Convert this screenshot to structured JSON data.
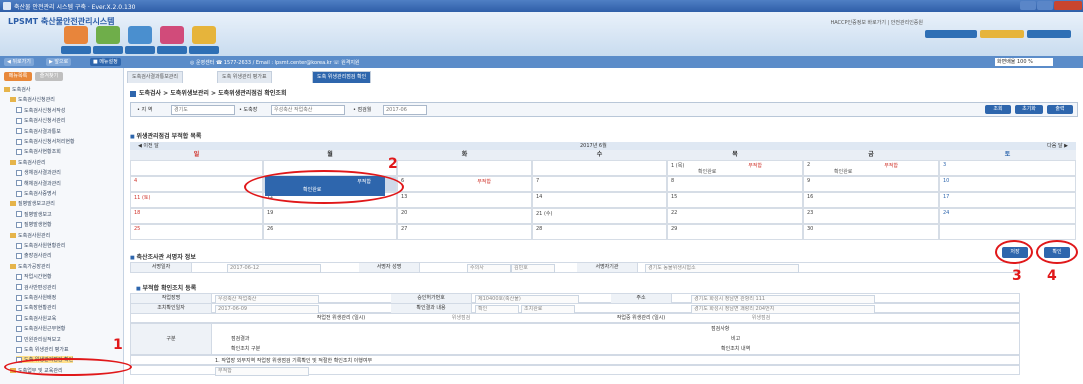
{
  "window": {
    "title": "축산물 안전관리 시스템 구축 · Ever.X.2.0.130"
  },
  "header": {
    "logo": "LPSMT 축산물안전관리시스템",
    "links": "HACCP인증정보 바로가기  |  안전관리인증원",
    "main_icons": [
      "",
      "",
      "",
      "",
      ""
    ]
  },
  "toolbar": {
    "back": "◀ 뒤로가기",
    "forward": "▶ 앞으로",
    "menu": "■ 메뉴설정",
    "contact": "◎ 운영센터 ☎ 1577-2633 / Email : lpsmt.center@korea.kr  ☏ 원격지원",
    "zoom": "화면배율 100 %"
  },
  "sidebar": {
    "tabs": [
      "메뉴목록",
      "즐겨찾기"
    ],
    "items": [
      {
        "label": "도축검사",
        "type": "folder",
        "indent": 0
      },
      {
        "label": "도축검사신청관리",
        "type": "folder",
        "indent": 1
      },
      {
        "label": "도축검사신청서작성",
        "type": "doc",
        "indent": 2
      },
      {
        "label": "도축검사신청서관리",
        "type": "doc",
        "indent": 2
      },
      {
        "label": "도축검사결과통보",
        "type": "doc",
        "indent": 2
      },
      {
        "label": "도축검사신청서처리현황",
        "type": "doc",
        "indent": 2
      },
      {
        "label": "도축검사현황조회",
        "type": "doc",
        "indent": 2
      },
      {
        "label": "도축검사관리",
        "type": "folder",
        "indent": 1
      },
      {
        "label": "생체검사결과관리",
        "type": "doc",
        "indent": 2
      },
      {
        "label": "해체검사결과관리",
        "type": "doc",
        "indent": 2
      },
      {
        "label": "도축검사증명서",
        "type": "doc",
        "indent": 2
      },
      {
        "label": "질병발생보고관리",
        "type": "folder",
        "indent": 1
      },
      {
        "label": "질병발생보고",
        "type": "doc",
        "indent": 2
      },
      {
        "label": "질병발생현황",
        "type": "doc",
        "indent": 2
      },
      {
        "label": "도축검사원관리",
        "type": "folder",
        "indent": 1
      },
      {
        "label": "도축검사원현황관리",
        "type": "doc",
        "indent": 2
      },
      {
        "label": "출장검사관리",
        "type": "doc",
        "indent": 2
      },
      {
        "label": "도축가공장관리",
        "type": "folder",
        "indent": 1
      },
      {
        "label": "작업시간현황",
        "type": "doc",
        "indent": 2
      },
      {
        "label": "검사반편성관리",
        "type": "doc",
        "indent": 2
      },
      {
        "label": "도축검사원배정",
        "type": "doc",
        "indent": 2
      },
      {
        "label": "도축장현황관리",
        "type": "doc",
        "indent": 2
      },
      {
        "label": "도축검사원교육",
        "type": "doc",
        "indent": 2
      },
      {
        "label": "도축검사원근무현황",
        "type": "doc",
        "indent": 2
      },
      {
        "label": "민원관리실적보고",
        "type": "doc",
        "indent": 2
      },
      {
        "label": "도축 위생관리 평가표",
        "type": "doc",
        "indent": 2
      },
      {
        "label": "도축 위생관리점검 확인",
        "type": "doc",
        "indent": 2,
        "highlight": true
      },
      {
        "label": "도축업무 및 교육관리",
        "type": "folder",
        "indent": 1
      }
    ]
  },
  "content_tabs": [
    "도축검사결과통보관리",
    "도축 위생관리 평가표",
    "도축 위생관리점검 확인"
  ],
  "breadcrumb": "도축검사 > 도축위생보관리 > 도축위생관리점검 확인조회",
  "filter": {
    "label1": "• 지 역",
    "value1": "경기도",
    "label2": "• 도축장",
    "value2": "우성축산 작업축산",
    "label3": "• 점검월",
    "value3": "2017-06",
    "buttons": [
      "조회",
      "초기화",
      "출력"
    ]
  },
  "calendar": {
    "section_title": "위생관리점검 부적합 목록",
    "nav_prev": "◀ 이전 달",
    "month": "2017년 6월",
    "nav_next": "다음 달 ▶",
    "days": [
      "일",
      "월",
      "화",
      "수",
      "목",
      "금",
      "토"
    ],
    "day_colors": [
      "#d0342c",
      "#333333",
      "#333333",
      "#333333",
      "#333333",
      "#333333",
      "#2e66ad"
    ],
    "weeks": [
      [
        {
          "n": ""
        },
        {
          "n": ""
        },
        {
          "n": ""
        },
        {
          "n": ""
        },
        {
          "n": "1 (목)",
          "ev": "부적합",
          "sub": "확인완료"
        },
        {
          "n": "2",
          "ev": "부적합",
          "sub": "확인완료"
        },
        {
          "n": "3"
        }
      ],
      [
        {
          "n": "4"
        },
        {
          "n": "5",
          "ev": "부적합",
          "sub": "확인완료",
          "sel": true
        },
        {
          "n": "6",
          "ev": "부적합"
        },
        {
          "n": "7"
        },
        {
          "n": "8"
        },
        {
          "n": "9"
        },
        {
          "n": "10"
        }
      ],
      [
        {
          "n": "11 (토)"
        },
        {
          "n": "12"
        },
        {
          "n": "13"
        },
        {
          "n": "14"
        },
        {
          "n": "15"
        },
        {
          "n": "16"
        },
        {
          "n": "17"
        }
      ],
      [
        {
          "n": "18"
        },
        {
          "n": "19"
        },
        {
          "n": "20"
        },
        {
          "n": "21 (수)"
        },
        {
          "n": "22"
        },
        {
          "n": "23"
        },
        {
          "n": "24"
        }
      ],
      [
        {
          "n": "25"
        },
        {
          "n": "26"
        },
        {
          "n": "27"
        },
        {
          "n": "28"
        },
        {
          "n": "29"
        },
        {
          "n": "30"
        },
        {
          "n": ""
        }
      ]
    ],
    "selected_event": {
      "title": "부적합",
      "sub": "확인완료"
    }
  },
  "inspector": {
    "section_title": "축산조사관 서명자 정보",
    "date_label": "서명일자",
    "date_value": "2017-06-12",
    "name_label": "서명자 성명",
    "name_value": "수의사",
    "name_value2": "김민호",
    "org_label": "서명자기관",
    "org_value": "경기도 동물위생시험소",
    "btn_save": "저장",
    "btn_confirm": "확인"
  },
  "form": {
    "section_title": "부적합 확인조치 등록",
    "r1": [
      "작업장명",
      "우성축산 작업축산",
      "승인허가번호",
      "제10400호(축산물)",
      "주소",
      "경기도 화성시 정남면 관항리 111"
    ],
    "r2": [
      "조치확인일자",
      "2017-06-09",
      "확인결과 내용",
      "확인",
      "조치완료",
      "경기도 화성시 정남면 괘랑리 204번지"
    ],
    "r3": [
      "작업전 위생관리 (일시)",
      "위생점검",
      "작업중 위생관리 (일시)",
      "위생점검"
    ],
    "r4_label": "구분",
    "r4_cols": [
      "점검사항",
      "점검결과",
      "비고",
      "확인조치 구분",
      "확인조치 내역"
    ],
    "r5": "1. 작업장 외부지역 작업장 위생점검 기록확인 및 적절한 확인조치 이행여부",
    "r6": "부적합"
  },
  "annotations": [
    "1",
    "2",
    "3",
    "4"
  ],
  "colors": {
    "accent": "#2e66ad",
    "annotation": "#e0181a"
  }
}
